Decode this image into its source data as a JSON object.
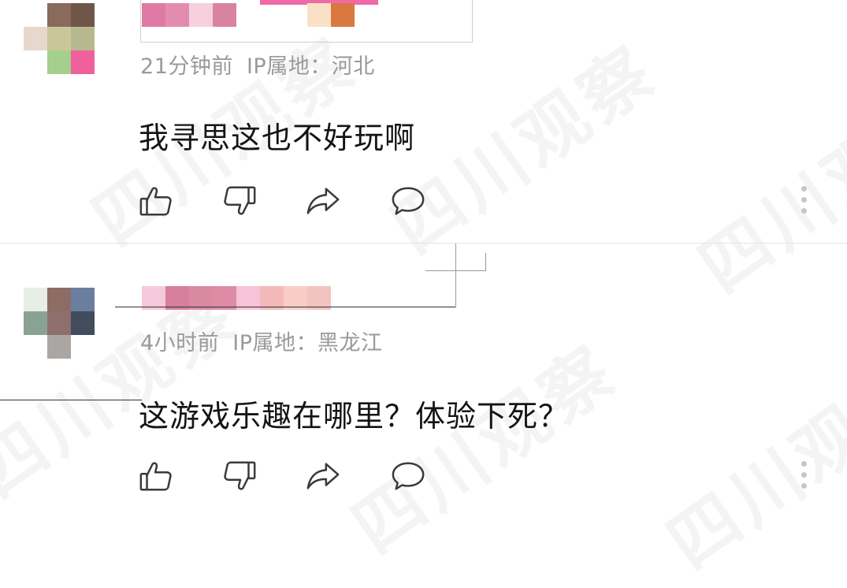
{
  "comments": [
    {
      "time": "21分钟前",
      "ip_label": "IP属地：",
      "ip_location": "河北",
      "text": "我寻思这也不好玩啊"
    },
    {
      "time": "4小时前",
      "ip_label": "IP属地：",
      "ip_location": "黑龙江",
      "text": "这游戏乐趣在哪里？体验下死？"
    }
  ],
  "actions": [
    "like-icon",
    "dislike-icon",
    "share-icon",
    "reply-icon",
    "more-icon"
  ],
  "watermark": "四川观察",
  "colors": {
    "meta": "#9a9a9a",
    "icon": "#3a3a3a",
    "text": "#141414"
  }
}
